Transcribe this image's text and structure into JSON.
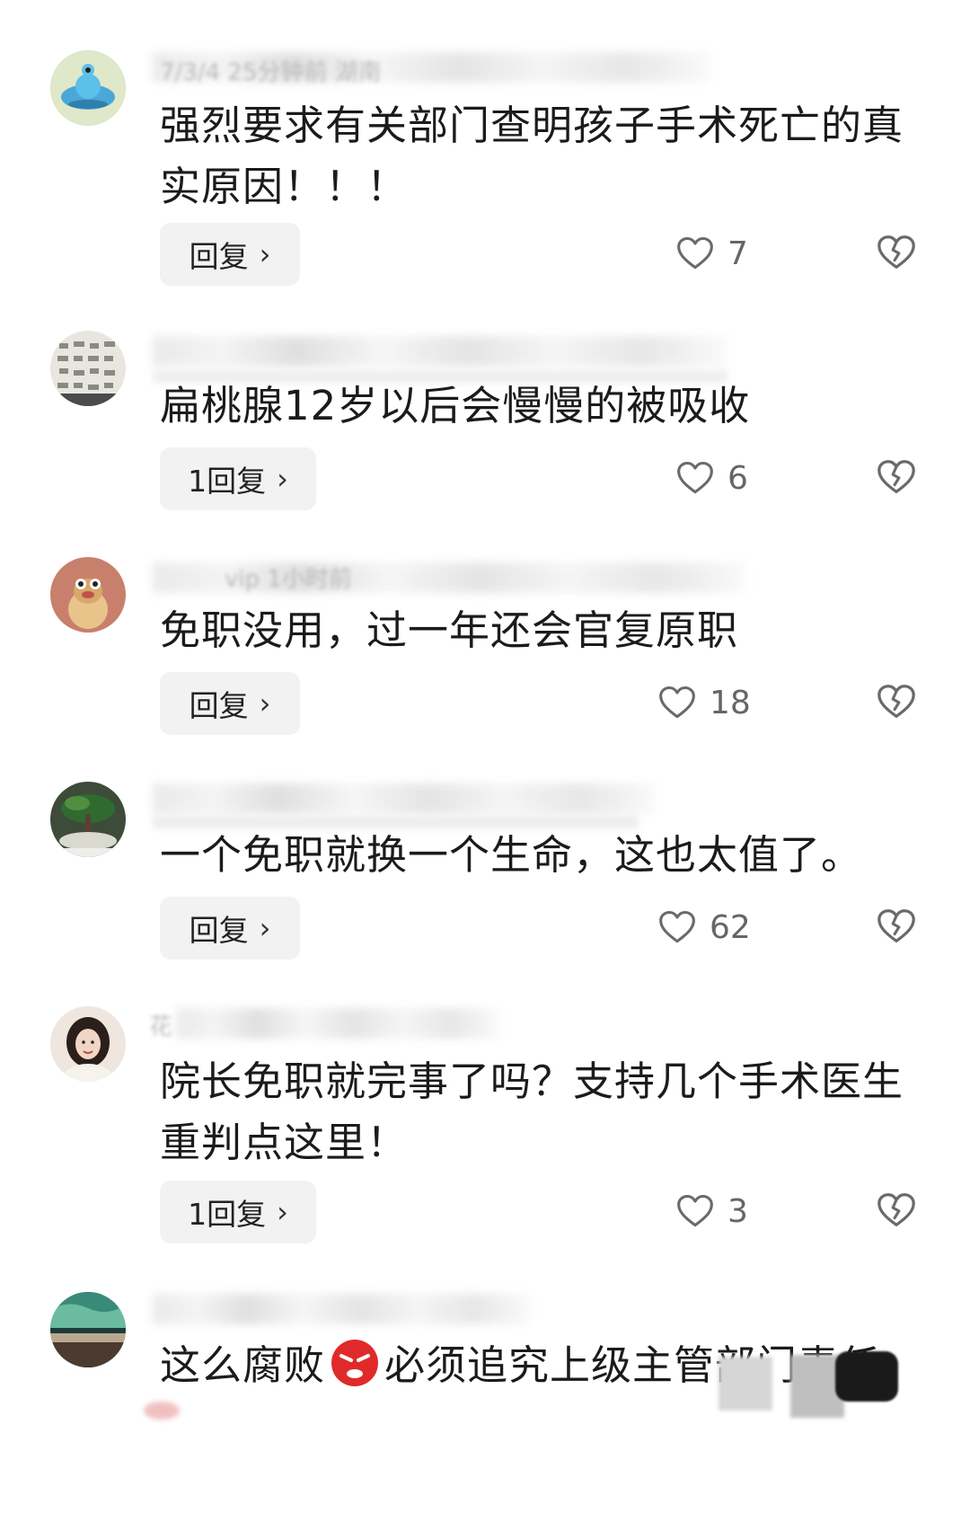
{
  "comments": [
    {
      "meta": "7/3/4 25分钟前 湖南",
      "text": "强烈要求有关部门查明孩子手术死亡的真实原因！！！",
      "reply_label": "回复",
      "likes": "7",
      "avatar_icon": "blue-alien-avatar"
    },
    {
      "meta": "",
      "text": "扁桃腺12岁以后会慢慢的被吸收",
      "reply_label": "1回复",
      "likes": "6",
      "avatar_icon": "handwriting-avatar"
    },
    {
      "meta": "vip 1小时前",
      "text": "免职没用，过一年还会官复原职",
      "reply_label": "回复",
      "likes": "18",
      "avatar_icon": "cartoon-bird-avatar"
    },
    {
      "meta": "",
      "text": "一个免职就换一个生命，这也太值了。",
      "reply_label": "回复",
      "likes": "62",
      "avatar_icon": "bonsai-avatar"
    },
    {
      "meta": "花",
      "text": "院长免职就完事了吗？支持几个手术医生重判点这里！",
      "reply_label": "1回复",
      "likes": "3",
      "avatar_icon": "woman-portrait-avatar"
    },
    {
      "meta": "",
      "text_before": "这么腐败",
      "emoji": "angry-face-emoji",
      "text_after": "必须追究上级主管部门责任",
      "avatar_icon": "landscape-avatar"
    }
  ],
  "colors": {
    "text": "#1b1b1b",
    "reply_bg": "#f2f2f2",
    "icon_gray": "#666666"
  }
}
